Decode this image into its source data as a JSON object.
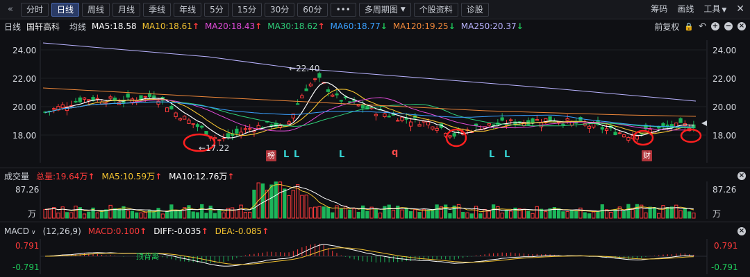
{
  "toolbar": {
    "back_icon": "double-chevron-left-icon",
    "periods": [
      "分时",
      "日线",
      "周线",
      "月线",
      "季线",
      "年线",
      "5分",
      "15分",
      "30分",
      "60分"
    ],
    "active_period": "日线",
    "more_label": "•••",
    "multi_period_label": "多周期图",
    "profile_label": "个股资料",
    "diagnose_label": "诊股",
    "right": {
      "chips_label": "筹码",
      "draw_label": "画线",
      "tools_label": "工具"
    }
  },
  "info": {
    "period_label": "日线",
    "stock_name": "国轩高科",
    "ma_label": "均线",
    "ma5": "MA5:18.58",
    "ma10": "MA10:18.61",
    "ma20": "MA20:18.43",
    "ma30": "MA30:18.62",
    "ma60": "MA60:18.77",
    "ma120": "MA120:19.25",
    "ma250": "MA250:20.37",
    "adjust_label": "前复权"
  },
  "colors": {
    "ma5": "#ffffff",
    "ma10": "#f2c230",
    "ma20": "#e04bd8",
    "ma30": "#2fd07a",
    "ma60": "#3aa0ff",
    "ma120": "#f0883a",
    "ma250": "#b9b3ff",
    "up": "#ff3b3b",
    "down": "#1db55a"
  },
  "price_axis": {
    "ticks": [
      "24.00",
      "22.00",
      "20.00",
      "18.00"
    ],
    "high_label": "22.40",
    "low_label": "17.22"
  },
  "markers": {
    "bang": "榜",
    "l": "L",
    "q": "q",
    "cai": "财"
  },
  "volume": {
    "title": "成交量",
    "total": "总量:19.64万",
    "ma5": "MA5:10.59万",
    "ma10": "MA10:12.76万",
    "top_tick": "87.26",
    "unit": "万"
  },
  "macd": {
    "title": "MACD",
    "params": "(12,26,9)",
    "macd_val": "MACD:0.100",
    "diff_val": "DIFF:-0.035",
    "dea_val": "DEA:-0.085",
    "top_tick": "0.791",
    "bottom_tick": "-0.791",
    "annotation": "顶背离"
  }
}
